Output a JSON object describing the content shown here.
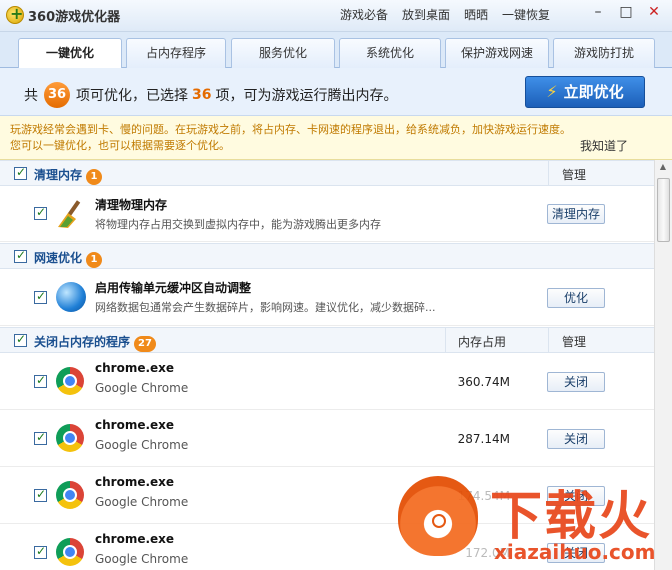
{
  "window": {
    "title": "360游戏优化器",
    "top_links": [
      "游戏必备",
      "放到桌面",
      "晒晒",
      "一键恢复"
    ],
    "controls": {
      "minimize": "–",
      "maximize": "□",
      "close": "✕"
    }
  },
  "tabs": [
    {
      "label": "一键优化",
      "active": true
    },
    {
      "label": "占内存程序",
      "active": false
    },
    {
      "label": "服务优化",
      "active": false
    },
    {
      "label": "系统优化",
      "active": false
    },
    {
      "label": "保护游戏网速",
      "active": false
    },
    {
      "label": "游戏防打扰",
      "active": false
    }
  ],
  "summary": {
    "prefix": "共",
    "total": "36",
    "middle": "项可优化，已选择",
    "selected": "36",
    "suffix": "项，可为游戏运行腾出内存。",
    "button": "立即优化"
  },
  "notice": {
    "line1": "玩游戏经常会遇到卡、慢的问题。在玩游戏之前，将占内存、卡网速的程序退出，给系统减负，加快游戏运行速度。",
    "line2": "您可以一键优化，也可以根据需要逐个优化。",
    "dismiss": "我知道了"
  },
  "sections": {
    "memory": {
      "title": "清理内存",
      "badge": "1",
      "manage": "管理",
      "item": {
        "title": "清理物理内存",
        "desc": "将物理内存占用交换到虚拟内存中，能为游戏腾出更多内存",
        "button": "清理内存"
      }
    },
    "network": {
      "title": "网速优化",
      "badge": "1",
      "item": {
        "title": "启用传输单元缓冲区自动调整",
        "desc": "网络数据包通常会产生数据碎片，影响网速。建议优化，减少数据碎...",
        "button": "优化"
      }
    },
    "programs": {
      "title": "关闭占内存的程序",
      "badge": "27",
      "col_mem": "内存占用",
      "col_manage": "管理",
      "items": [
        {
          "name": "chrome.exe",
          "desc": "Google Chrome",
          "mem": "360.74M",
          "button": "关闭"
        },
        {
          "name": "chrome.exe",
          "desc": "Google Chrome",
          "mem": "287.14M",
          "button": "关闭"
        },
        {
          "name": "chrome.exe",
          "desc": "Google Chrome",
          "mem": "174.54M",
          "button": "关闭"
        },
        {
          "name": "chrome.exe",
          "desc": "Google Chrome",
          "mem": "172.0M",
          "button": "关闭"
        }
      ]
    }
  },
  "watermark": {
    "brand": "下载火",
    "url": "xiazaihuo.com"
  },
  "colors": {
    "accent": "#1c5fb8",
    "badge": "#f08a1a",
    "notice": "#c07a00",
    "watermark": "#e8461a"
  }
}
